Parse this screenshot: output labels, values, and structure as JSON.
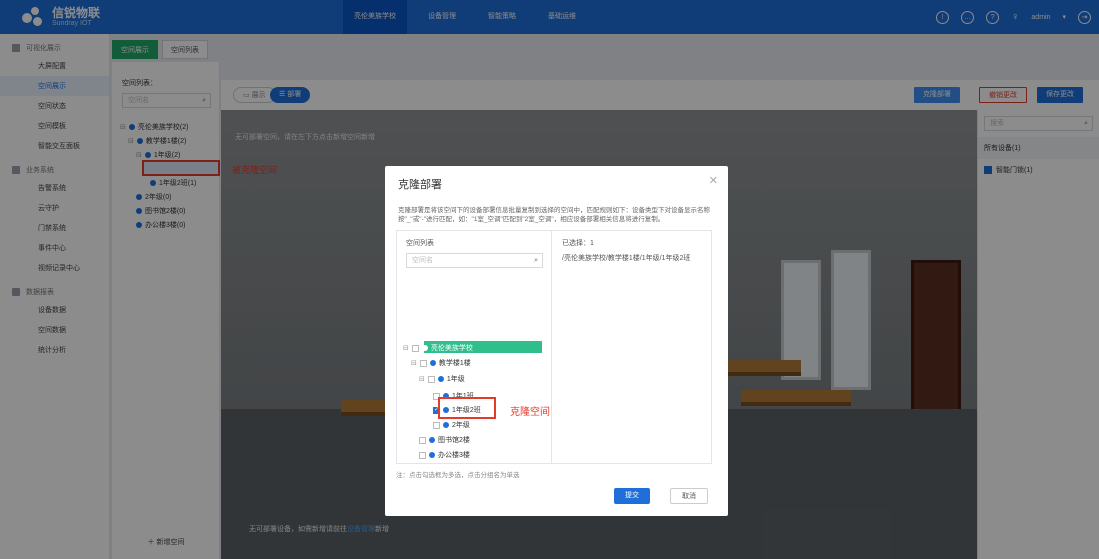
{
  "brand": {
    "name": "信锐物联",
    "sub": "Sundray IOT"
  },
  "topnav": {
    "tabs": [
      "亮伦美族学校",
      "设备管理",
      "智能策略",
      "基础运维"
    ]
  },
  "user": {
    "name": "admin"
  },
  "sidebar": {
    "groups": [
      {
        "label": "可视化展示",
        "items": [
          "大屏配置",
          "空间展示",
          "空间状态",
          "空间模板",
          "智能交互面板"
        ]
      },
      {
        "label": "业务系统",
        "items": [
          "告警系统",
          "云守护",
          "门禁系统",
          "事件中心",
          "视频记录中心"
        ]
      },
      {
        "label": "数据报表",
        "items": [
          "设备数据",
          "空间数据",
          "统计分析"
        ]
      }
    ]
  },
  "tabs": [
    "空间展示",
    "空间列表"
  ],
  "tree": {
    "label": "空间列表：",
    "search_placeholder": "空间名",
    "nodes": [
      "亮伦美族学校(2)",
      "教学楼1楼(2)",
      "1年级(2)",
      "1年1班...",
      "1年级2班(1)",
      "2年级(0)",
      "图书馆2楼(0)",
      "办公楼3楼(0)"
    ],
    "add": "新增空间"
  },
  "toolbar": {
    "mode_view": "展示",
    "mode_deploy": "部署",
    "clone": "克隆部署",
    "revoke": "撤销更改",
    "save": "保存更改"
  },
  "canvas": {
    "hint_top": "无可部署空间，请在左下方点击新增空间新增",
    "hint_bottom_a": "无可部署设备，如需新增请前往",
    "hint_link": "设备管理",
    "hint_bottom_b": "新增"
  },
  "right": {
    "search_placeholder": "搜索",
    "all": "所有设备(1)",
    "item": "智能门锁(1)"
  },
  "annot": {
    "a": "被克隆空间",
    "b": "克隆空间"
  },
  "modal": {
    "title": "克隆部署",
    "desc": "克隆部署是将该空间下的设备部署信息批量复制到选择的空间中，匹配规则如下：设备类型下对设备显示名称按\"_\"或\"-\"进行匹配，如：\"1室_空调\"匹配到\"2室_空调\"，相应设备部署相关信息将进行复制。",
    "list_title": "空间列表",
    "search_placeholder": "空间名",
    "selected_label": "已选择：1",
    "selected_path": "/亮伦美族学校/教学楼1楼/1年级/1年级2班",
    "nodes": [
      "亮伦美族学校",
      "教学楼1楼",
      "1年级",
      "1年1班",
      "1年级2班",
      "2年级",
      "图书馆2楼",
      "办公楼3楼"
    ],
    "note": "注：点击勾选框为多选，点击分组名为单选",
    "ok": "提交",
    "cancel": "取消"
  }
}
